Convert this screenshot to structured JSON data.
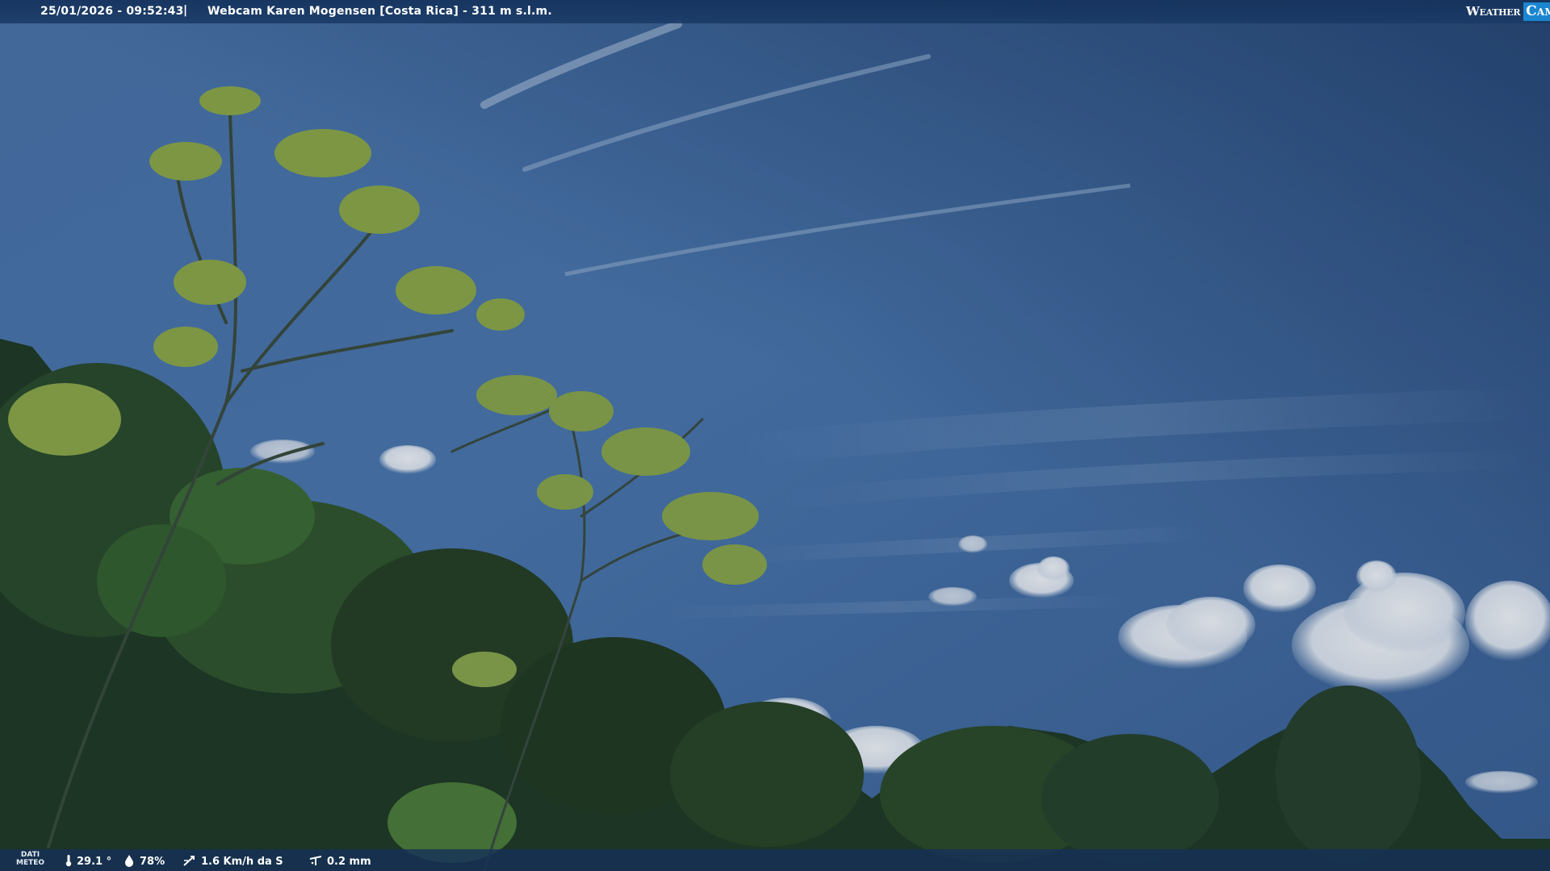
{
  "header": {
    "datetime": "25/01/2026 - 09:52:43",
    "separator": "|",
    "title": "Webcam Karen Mogensen [Costa Rica] - 311 m s.l.m."
  },
  "logo": {
    "left_text": "Weather",
    "right_text": "Cam"
  },
  "meteo": {
    "label_line1": "DATI",
    "label_line2": "METEO",
    "temperature": "29.1 °",
    "humidity": "78%",
    "wind": "1.6 Km/h da S",
    "rain": "0.2 mm"
  },
  "icons": {
    "temperature": "thermometer-icon",
    "humidity": "water-drop-icon",
    "wind": "wind-vane-icon",
    "rain": "rain-gauge-icon"
  },
  "colors": {
    "sky_top": "#2a4a78",
    "sky_mid": "#4c77ab",
    "bar": "#17375f",
    "accent": "#1b86cf"
  }
}
